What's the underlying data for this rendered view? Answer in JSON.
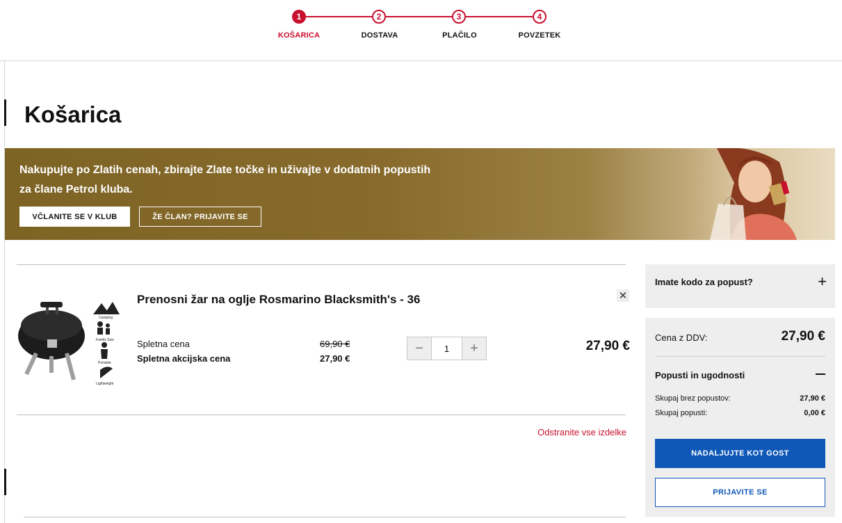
{
  "stepper": {
    "steps": [
      {
        "number": "1",
        "label": "KOŠARICA",
        "state": "active"
      },
      {
        "number": "2",
        "label": "DOSTAVA",
        "state": "upcoming"
      },
      {
        "number": "3",
        "label": "PLAČILO",
        "state": "upcoming"
      },
      {
        "number": "4",
        "label": "POVZETEK",
        "state": "upcoming"
      }
    ]
  },
  "page": {
    "title": "Košarica"
  },
  "promo": {
    "text": "Nakupujte po Zlatih cenah, zbirajte Zlate točke in uživajte v dodatnih popustih za člane Petrol kluba.",
    "join_button": "VČLANITE SE V KLUB",
    "login_button": "ŽE ČLAN? PRIJAVITE SE"
  },
  "cart": {
    "item": {
      "name": "Prenosni žar na oglje Rosmarino Blacksmith's - 36",
      "image_icons": [
        "Camping",
        "Family Size",
        "Portable",
        "Lightweight"
      ],
      "online_price_label": "Spletna cena",
      "online_price": "69,90 €",
      "sale_price_label": "Spletna akcijska cena",
      "sale_price": "27,90 €",
      "quantity": "1",
      "line_total": "27,90 €",
      "remove_icon": "close-icon"
    },
    "remove_all": "Odstranite vse izdelke"
  },
  "sidebar": {
    "coupon_label": "Imate kodo za popust?",
    "coupon_icon": "plus-icon",
    "price_incl_vat_label": "Cena z DDV:",
    "price_incl_vat": "27,90 €",
    "discounts_label": "Popusti in ugodnosti",
    "discounts_icon": "minus-icon",
    "total_no_discount_label": "Skupaj brez popustov:",
    "total_no_discount": "27,90 €",
    "total_discount_label": "Skupaj popusti:",
    "total_discount": "0,00 €",
    "guest_button": "NADALJUJTE KOT GOST",
    "login_button": "PRIJAVITE SE"
  },
  "colors": {
    "accent": "#c8102e",
    "primary_blue": "#0f58b8",
    "gold": "#876a2c"
  }
}
